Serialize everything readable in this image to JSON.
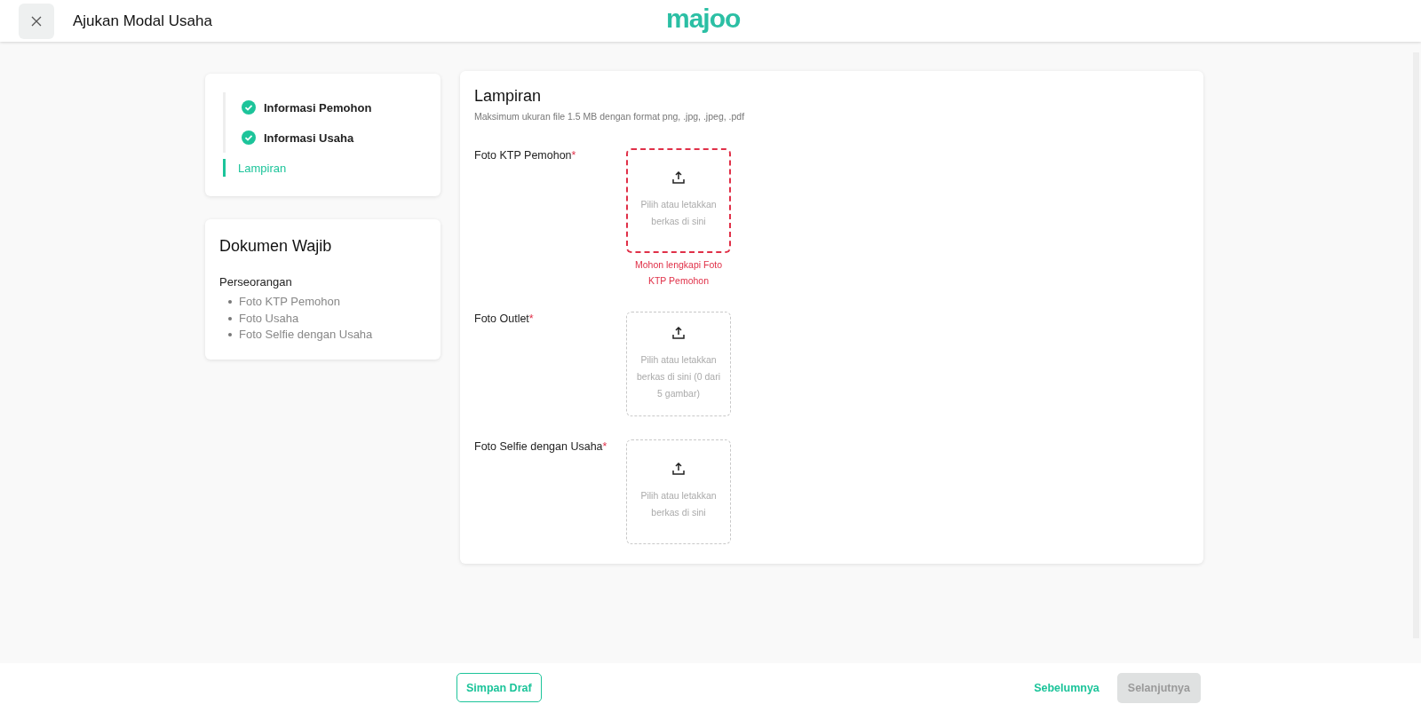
{
  "header": {
    "title": "Ajukan Modal Usaha",
    "logo": "majoo"
  },
  "steps": [
    {
      "label": "Informasi Pemohon",
      "completed": true,
      "selected": false
    },
    {
      "label": "Informasi Usaha",
      "completed": true,
      "selected": false
    },
    {
      "label": "Lampiran",
      "completed": false,
      "selected": true
    }
  ],
  "required_docs": {
    "title": "Dokumen Wajib",
    "group": "Perseorangan",
    "items": [
      "Foto KTP Pemohon",
      "Foto Usaha",
      "Foto Selfie dengan Usaha"
    ]
  },
  "attachments": {
    "title": "Lampiran",
    "subtitle": "Maksimum ukuran file 1.5 MB dengan format png, .jpg, .jpeg, .pdf",
    "fields": [
      {
        "label": "Foto KTP Pemohon",
        "required_mark": "*",
        "hint": "Pilih atau letakkan berkas di sini",
        "error": true,
        "error_message": "Mohon lengkapi Foto KTP Pemohon"
      },
      {
        "label": "Foto Outlet",
        "required_mark": "*",
        "hint": "Pilih atau letakkan berkas di sini (0 dari 5 gambar)",
        "error": false
      },
      {
        "label": "Foto Selfie dengan Usaha",
        "required_mark": "*",
        "hint": "Pilih atau letakkan berkas di sini",
        "error": false
      }
    ]
  },
  "footer": {
    "save_draft": "Simpan Draf",
    "previous": "Sebelumnya",
    "next": {
      "label": "Selanjutnya",
      "disabled": true
    }
  }
}
